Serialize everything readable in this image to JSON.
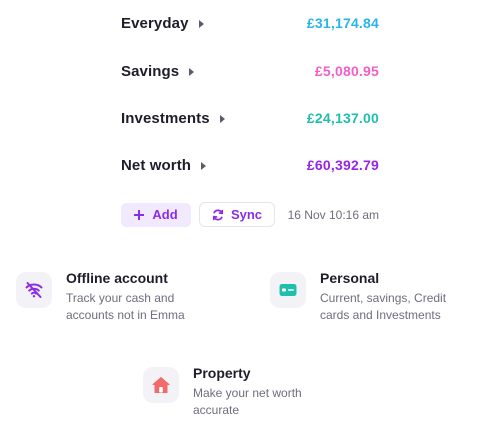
{
  "accounts": [
    {
      "label": "Everyday",
      "amount": "£31,174.84",
      "color": "#29b5e8"
    },
    {
      "label": "Savings",
      "amount": "£5,080.95",
      "color": "#f05fc6"
    },
    {
      "label": "Investments",
      "amount": "£24,137.00",
      "color": "#1fbfae"
    },
    {
      "label": "Net worth",
      "amount": "£60,392.79",
      "color": "#9a24e6"
    }
  ],
  "actions": {
    "add_label": "Add",
    "sync_label": "Sync",
    "last_synced": "16 Nov 10:16 am"
  },
  "cards": {
    "offline": {
      "title": "Offline account",
      "desc_line1": "Track your cash and",
      "desc_line2": "accounts not in Emma",
      "icon": "wifi-off-icon"
    },
    "personal": {
      "title": "Personal",
      "desc_line1": "Current, savings, Credit",
      "desc_line2": "cards and Investments",
      "icon": "card-icon"
    },
    "property": {
      "title": "Property",
      "desc_line1": "Make your net worth",
      "desc_line2": "accurate",
      "icon": "house-icon"
    }
  },
  "accent_color": "#8a2ce8"
}
